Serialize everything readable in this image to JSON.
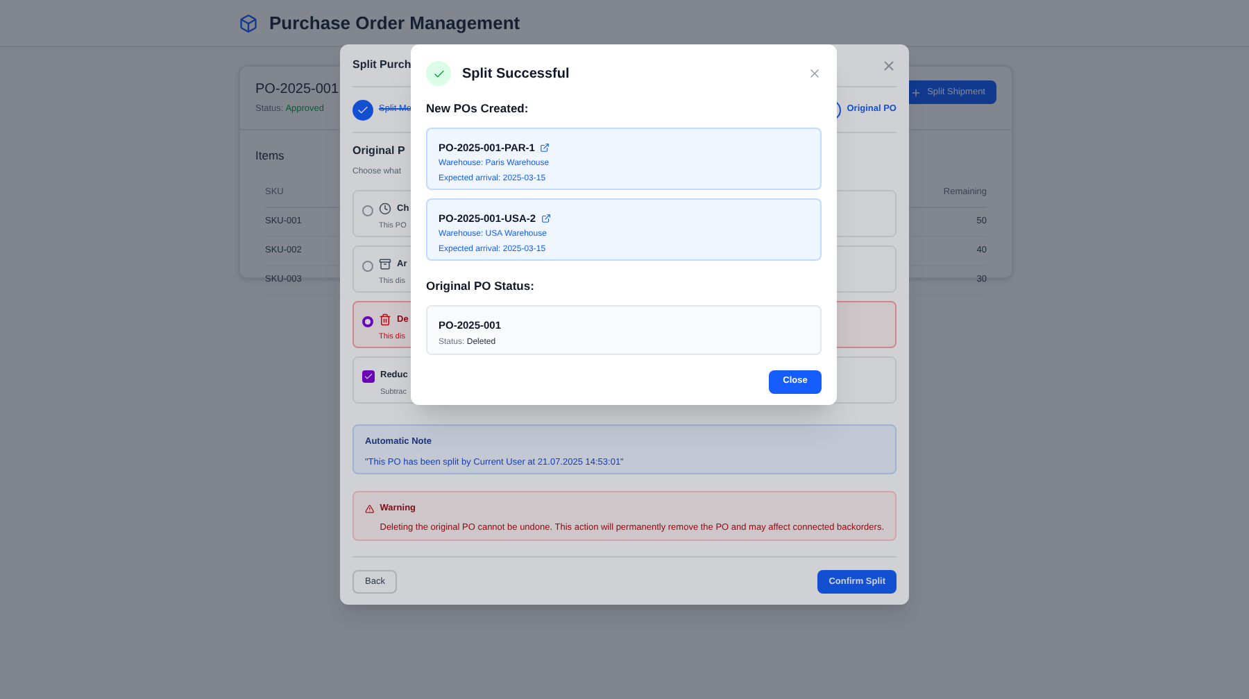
{
  "app": {
    "title": "Purchase Order Management"
  },
  "po_card": {
    "number": "PO-2025-001",
    "status_label": "Status:",
    "status": "Approved",
    "split_button": "Split Shipment",
    "items_title": "Items",
    "columns": [
      "SKU",
      "Remaining"
    ],
    "rows": [
      {
        "sku": "SKU-001",
        "remaining": "50"
      },
      {
        "sku": "SKU-002",
        "remaining": "40"
      },
      {
        "sku": "SKU-003",
        "remaining": "30"
      }
    ]
  },
  "split_dialog": {
    "title": "Split Purch",
    "steps": [
      {
        "label": "Split Me",
        "done": true
      },
      {
        "label": "Original PO",
        "done": false
      }
    ],
    "section_title": "Original P",
    "section_hint": "Choose what",
    "options": [
      {
        "kind": "radio",
        "title": "Ch",
        "description": "This PO",
        "selected": false
      },
      {
        "kind": "radio",
        "title": "Ar",
        "description": "This dis",
        "selected": false
      },
      {
        "kind": "radio",
        "title": "De",
        "description": "This dis",
        "selected": true
      },
      {
        "kind": "checkbox",
        "title": "Reduc",
        "description": "Subtrac",
        "checked": true
      }
    ],
    "note": {
      "title": "Automatic Note",
      "text": "\"This PO has been split by Current User at 21.07.2025 14:53:01\""
    },
    "warning": {
      "title": "Warning",
      "text": "Deleting the original PO cannot be undone. This action will permanently remove the PO and may affect connected backorders."
    },
    "buttons": {
      "back": "Back",
      "confirm": "Confirm Split"
    }
  },
  "success_dialog": {
    "title": "Split Successful",
    "new_title": "New POs Created:",
    "new_pos": [
      {
        "number": "PO-2025-001-PAR-1",
        "warehouse": "Warehouse: Paris Warehouse",
        "arrival": "Expected arrival: 2025-03-15"
      },
      {
        "number": "PO-2025-001-USA-2",
        "warehouse": "Warehouse: USA Warehouse",
        "arrival": "Expected arrival: 2025-03-15"
      }
    ],
    "original_title": "Original PO Status:",
    "original": {
      "number": "PO-2025-001",
      "status_label": "Status:",
      "status": "Deleted"
    },
    "close": "Close"
  }
}
